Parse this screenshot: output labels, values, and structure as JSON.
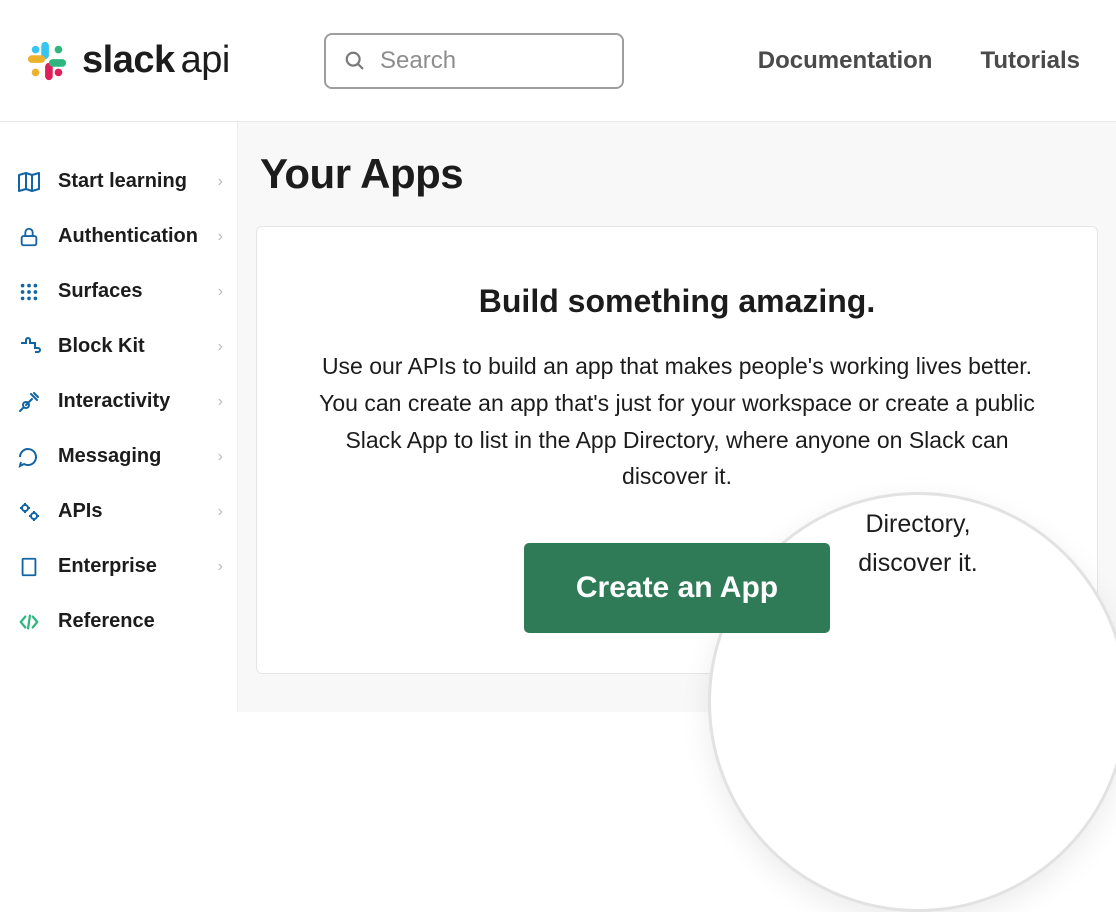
{
  "brand": {
    "bold": "slack",
    "light": "api"
  },
  "search": {
    "placeholder": "Search"
  },
  "topnav": {
    "docs": "Documentation",
    "tutorials": "Tutorials"
  },
  "sidebar": {
    "items": [
      {
        "label": "Start learning"
      },
      {
        "label": "Authentication"
      },
      {
        "label": "Surfaces"
      },
      {
        "label": "Block Kit"
      },
      {
        "label": "Interactivity"
      },
      {
        "label": "Messaging"
      },
      {
        "label": "APIs"
      },
      {
        "label": "Enterprise"
      },
      {
        "label": "Reference"
      }
    ]
  },
  "main": {
    "title": "Your Apps",
    "panel_title": "Build something amazing.",
    "panel_copy": "Use our APIs to build an app that makes people's working lives better. You can create an app that's just for your workspace or create a public Slack App to list in the App Directory, where anyone on Slack can discover it.",
    "lens_line1": "Directory,",
    "lens_line2": "discover it.",
    "cta": "Create an App"
  }
}
